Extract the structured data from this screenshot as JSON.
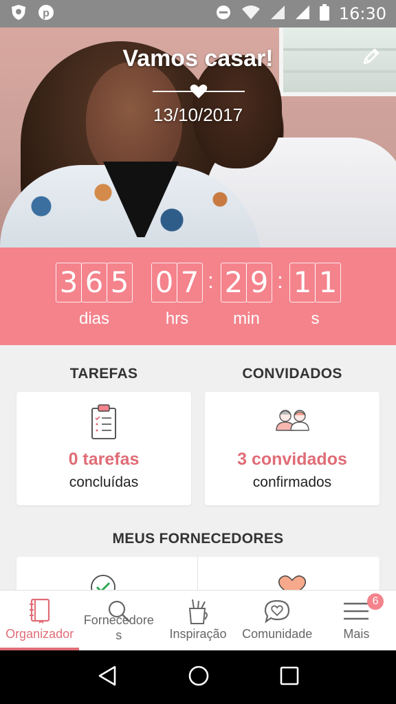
{
  "status_bar": {
    "time": "16:30",
    "icons": [
      "shield-icon",
      "pinterest-icon",
      "do-not-disturb-icon",
      "wifi-icon",
      "signal-icon",
      "signal-icon",
      "battery-icon"
    ]
  },
  "hero": {
    "title": "Vamos casar!",
    "date": "13/10/2017",
    "edit_icon": "pencil-icon"
  },
  "countdown": {
    "days": [
      "3",
      "6",
      "5"
    ],
    "hours": [
      "0",
      "7"
    ],
    "minutes": [
      "2",
      "9"
    ],
    "seconds": [
      "1",
      "1"
    ],
    "labels": {
      "days": "dias",
      "hours": "hrs",
      "minutes": "min",
      "seconds": "s"
    }
  },
  "tasks": {
    "title": "TAREFAS",
    "count": "0 tarefas",
    "subtitle": "concluídas",
    "icon": "clipboard-icon"
  },
  "guests": {
    "title": "CONVIDADOS",
    "count": "3 convidados",
    "subtitle": "confirmados",
    "icon": "guests-icon"
  },
  "vendors": {
    "title": "MEUS FORNECEDORES",
    "icons": [
      "check-circle-icon",
      "heart-icon"
    ]
  },
  "bottom_nav": {
    "items": [
      {
        "label": "Organizador",
        "icon": "notebook-icon",
        "active": true
      },
      {
        "label": "Fornecedores",
        "icon": "search-icon",
        "active": false
      },
      {
        "label": "Inspiração",
        "icon": "pencil-cup-icon",
        "active": false
      },
      {
        "label": "Comunidade",
        "icon": "chat-heart-icon",
        "active": false
      },
      {
        "label": "Mais",
        "icon": "menu-icon",
        "active": false,
        "badge": "6"
      }
    ]
  },
  "colors": {
    "accent": "#f4838c",
    "accent_text": "#e06c76"
  }
}
